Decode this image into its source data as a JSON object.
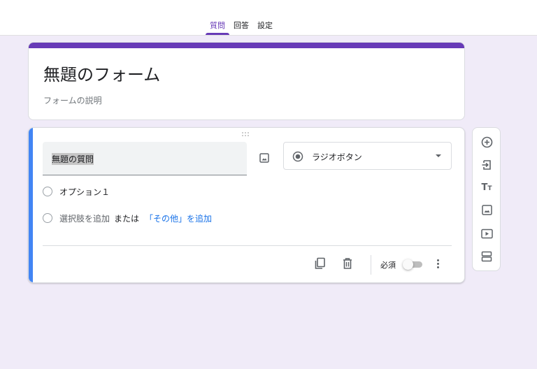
{
  "tabs": [
    {
      "label": "質問",
      "active": true
    },
    {
      "label": "回答",
      "active": false
    },
    {
      "label": "設定",
      "active": false
    }
  ],
  "form": {
    "title": "無題のフォーム",
    "description": "フォームの説明"
  },
  "question": {
    "title": "無題の質問",
    "type": "ラジオボタン",
    "options": [
      "オプション１"
    ],
    "add_option": "選択肢を追加",
    "or_text": "または",
    "add_other": "「その他」を追加",
    "required_label": "必須",
    "required": false
  },
  "side_toolbar": [
    "add-question-icon",
    "import-questions-icon",
    "add-title-icon",
    "add-image-icon",
    "add-video-icon",
    "add-section-icon"
  ],
  "colors": {
    "accent": "#673ab7",
    "active_border": "#4285f4",
    "background": "#f0ebf8",
    "link": "#1a73e8"
  }
}
